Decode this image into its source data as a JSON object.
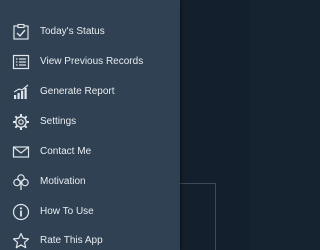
{
  "drawer": {
    "items": [
      {
        "label": "Today's Status",
        "icon": "checklist-icon"
      },
      {
        "label": "View Previous Records",
        "icon": "list-icon"
      },
      {
        "label": "Generate Report",
        "icon": "bar-chart-icon"
      },
      {
        "label": "Settings",
        "icon": "gear-icon"
      },
      {
        "label": "Contact Me",
        "icon": "envelope-icon"
      },
      {
        "label": "Motivation",
        "icon": "clover-icon"
      },
      {
        "label": "How To Use",
        "icon": "info-icon"
      },
      {
        "label": "Rate This App",
        "icon": "star-icon"
      }
    ]
  },
  "colors": {
    "drawer_bg": "#2f4152",
    "backdrop_bg": "#131f2c",
    "text": "#e9edf1",
    "icon": "#dfe5ea"
  }
}
